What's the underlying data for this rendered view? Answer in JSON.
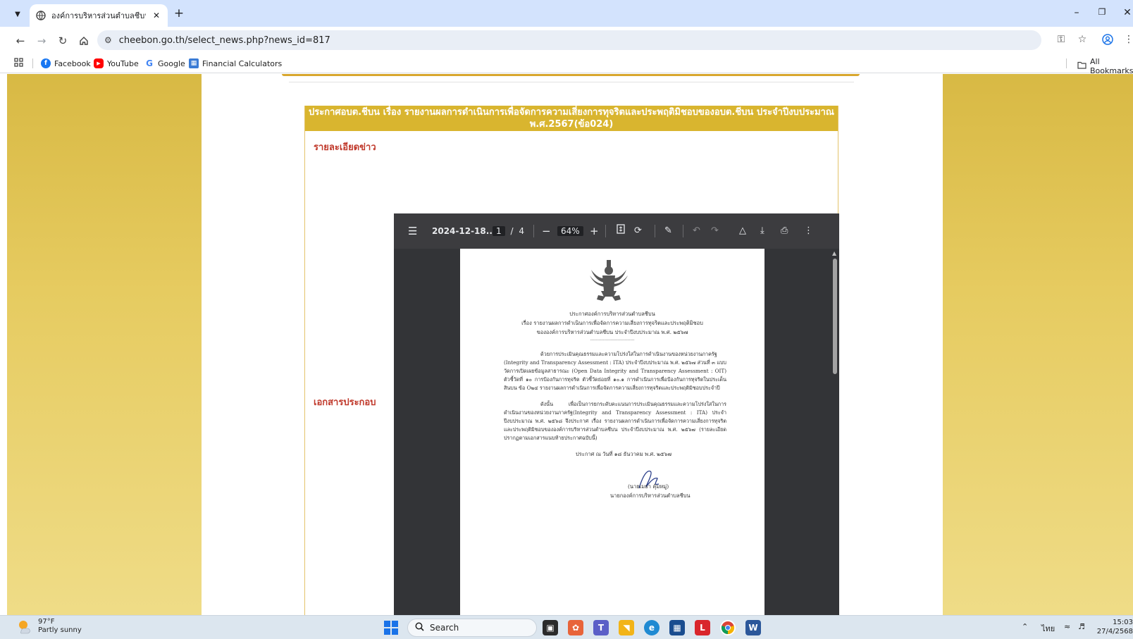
{
  "browser": {
    "tab_title": "องค์การบริหารส่วนตำบลชีบน อำเภอ",
    "new_tab": "+",
    "url": "cheebon.go.th/select_news.php?news_id=817",
    "bookmarks": [
      {
        "label": "Facebook",
        "icon": "facebook-icon",
        "color": "#1877f2"
      },
      {
        "label": "YouTube",
        "icon": "youtube-icon",
        "color": "#ff0000"
      },
      {
        "label": "Google",
        "icon": "google-icon",
        "color": "#4285f4"
      },
      {
        "label": "Financial Calculators",
        "icon": "calculator-icon",
        "color": "#3a7bd5"
      }
    ],
    "all_bookmarks": "All Bookmarks"
  },
  "news": {
    "title_line1": "ประกาศอบต.ชีบน เรื่อง รายงานผลการดำเนินการเพื่อจัดการความเสี่ยงการทุจริตและประพฤติมิชอบของอบต.ชีบน ประจำปีงบประมาณ",
    "title_line2": "พ.ศ.2567(ข้อ024)",
    "detail_label": "รายละเอียดข่าว",
    "attachment_label": "เอกสารประกอบ"
  },
  "pdf": {
    "filename": "2024-12-18...",
    "page_current": "1",
    "page_sep": "/",
    "page_total": "4",
    "zoom": "64%",
    "zoom_out": "−",
    "zoom_in": "+",
    "doc": {
      "heading1": "ประกาศองค์การบริหารส่วนตำบลชีบน",
      "heading2": "เรื่อง   รายงานผลการดำเนินการเพื่อจัดการความเสี่ยงการทุจริตและประพฤติมิชอบ",
      "heading3": "ขององค์การบริหารส่วนตำบลชีบน  ประจำปีงบประมาณ พ.ศ. ๒๕๖๗",
      "divider": "-------------------------------",
      "para1": "ด้วยการประเมินคุณธรรมและความโปร่งใสในการดำเนินงานของหน่วยงานภาครัฐ (Integrity and Transparency Assessment : ITA) ประจำปีงบประมาณ พ.ศ. ๒๕๖๗ ส่วนที่ ๓ แบบวัดการเปิดเผยข้อมูลสาธารณะ (Open Data Integrity and Transparency Assessment : OIT) ตัวชี้วัดที่ ๑๐ การป้องกันการทุจริต ตัวชี้วัดย่อยที่ ๑๐.๑ การดำเนินการเพื่อป้องกันการทุจริตในประเด็นสินบน ข้อ O๒๔ รายงานผลการดำเนินการเพื่อจัดการความเสี่ยงการทุจริตและประพฤติมิชอบประจำปี",
      "para2": "ดังนั้น เพื่อเป็นการยกระดับคะแนนการประเมินคุณธรรมและความโปร่งใสในการดำเนินงานของหน่วยงานภาครัฐ(Integrity and Transparency Assessment : ITA) ประจำปีงบประมาณ พ.ศ. ๒๕๖๘  จึงประกาศ เรื่อง รายงานผลการดำเนินการเพื่อจัดการความเสี่ยงการทุจริตและประพฤติมิชอบขององค์การบริหารส่วนตำบลชีบน  ประจำปีงบประมาณ พ.ศ. ๒๕๖๗ (รายละเอียดปรากฏตามเอกสารแนบท้ายประกาศฉบับนี้)",
      "announce_date": "ประกาศ ณ วันที่    ๑๘  ธันวาคม พ.ศ. ๒๕๖๗",
      "signer_name": "(นายเมธา  คุ้มหมู่)",
      "signer_title": "นายกองค์การบริหารส่วนตำบลชีบน"
    }
  },
  "taskbar": {
    "temp": "97°F",
    "condition": "Partly sunny",
    "search_placeholder": "Search",
    "lang": "ไทย",
    "time": "15:03",
    "date": "27/4/2568"
  },
  "colors": {
    "accent_gold": "#d9b52f",
    "label_red": "#c0392b",
    "pdf_dark": "#333437"
  }
}
